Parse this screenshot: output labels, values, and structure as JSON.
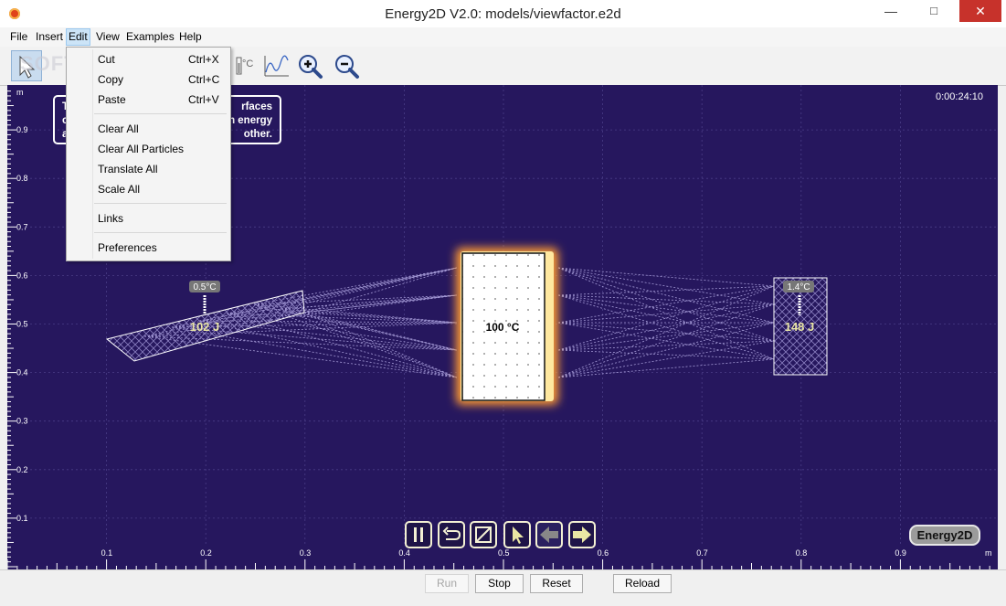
{
  "window": {
    "title": "Energy2D V2.0: models/viewfactor.e2d",
    "minimize": "—",
    "maximize": "□",
    "close": "✕"
  },
  "menubar": [
    {
      "label": "File"
    },
    {
      "label": "Insert"
    },
    {
      "label": "Edit"
    },
    {
      "label": "View"
    },
    {
      "label": "Examples"
    },
    {
      "label": "Help"
    }
  ],
  "toolbar": {
    "watermark": "SOFTPEDIA",
    "icons": [
      "selection-icon",
      "thermometer-icon",
      "graph-icon",
      "zoom-in-icon",
      "zoom-out-icon"
    ],
    "unit_glyph": "°C"
  },
  "edit_menu": {
    "items": [
      {
        "label": "Cut",
        "shortcut": "Ctrl+X"
      },
      {
        "label": "Copy",
        "shortcut": "Ctrl+C"
      },
      {
        "label": "Paste",
        "shortcut": "Ctrl+V"
      },
      {
        "label": "Clear All",
        "shortcut": ""
      },
      {
        "label": "Clear All Particles",
        "shortcut": ""
      },
      {
        "label": "Translate All",
        "shortcut": ""
      },
      {
        "label": "Scale All",
        "shortcut": ""
      },
      {
        "label": "Links",
        "shortcut": ""
      },
      {
        "label": "Preferences",
        "shortcut": ""
      }
    ]
  },
  "simulation": {
    "clock": "0:00:24:10",
    "note_line1": "rfaces",
    "note_line2": "n energy",
    "note_line3": "other.",
    "note_left1": "T",
    "note_left2": "c",
    "note_left3": "a",
    "left_sensor": "0.5°C",
    "left_energy": "102 J",
    "center_temp": "100 °C",
    "right_sensor": "1.4°C",
    "right_energy": "148 J",
    "y_axis_unit": "m",
    "x_axis_unit": "m",
    "y_ticks": [
      "0.9",
      "0.8",
      "0.7",
      "0.6",
      "0.5",
      "0.4",
      "0.3",
      "0.2",
      "0.1"
    ],
    "x_ticks": [
      "0.1",
      "0.2",
      "0.3",
      "0.4",
      "0.5",
      "0.6",
      "0.7",
      "0.8",
      "0.9"
    ],
    "brand": "Energy2D"
  },
  "bottom_buttons": {
    "run": "Run",
    "stop": "Stop",
    "reset": "Reset",
    "reload": "Reload"
  }
}
